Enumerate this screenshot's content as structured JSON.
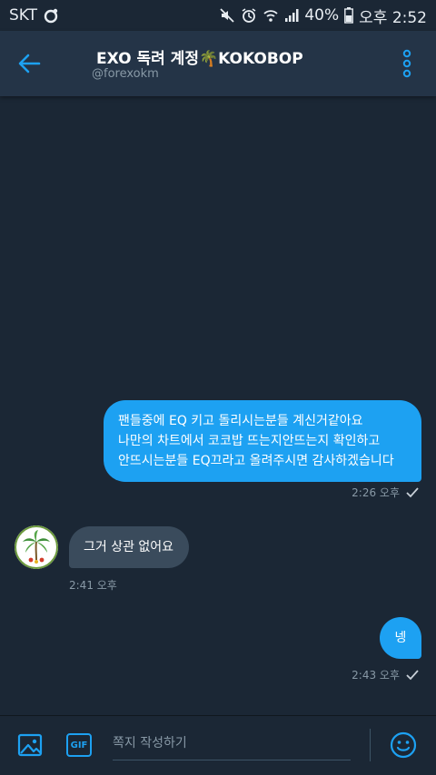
{
  "status_bar": {
    "carrier": "SKT",
    "battery": "40%",
    "time": "오후 2:52"
  },
  "header": {
    "title": "EXO 독려 계정🌴KOKOBOP",
    "handle": "@forexokm"
  },
  "messages": [
    {
      "direction": "out",
      "lines": [
        "팬들중에 EQ 키고 돌리시는분들 계신거같아요",
        "나만의 차트에서 코코밥 뜨는지안뜨는지 확인하고",
        "안뜨시는분들 EQ끄라고 올려주시면 감사하겠습니다"
      ],
      "time": "2:26 오후"
    },
    {
      "direction": "in",
      "text": "그거 상관 없어요",
      "time": "2:41 오후"
    },
    {
      "direction": "out",
      "text": "넹",
      "time": "2:43 오후"
    }
  ],
  "composer": {
    "placeholder": "쪽지 작성하기",
    "gif_label": "GIF"
  },
  "colors": {
    "accent": "#1da1f2",
    "background": "#1b2735",
    "header": "#243447",
    "incoming_bubble": "#3a4b5c",
    "muted_text": "#8899a6"
  }
}
